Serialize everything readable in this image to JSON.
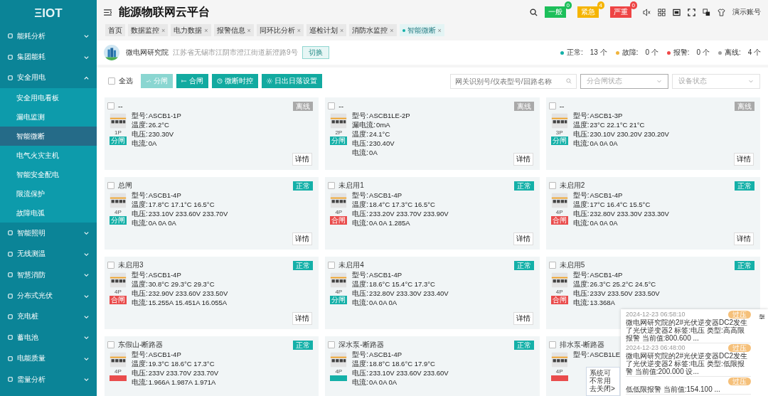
{
  "logo": "ΞIOT",
  "sidebar": {
    "items": [
      {
        "label": "能耗分析",
        "expanded": false
      },
      {
        "label": "集团能耗",
        "expanded": false
      },
      {
        "label": "安全用电",
        "expanded": true,
        "children": [
          {
            "label": "安全用电看板",
            "selected": false
          },
          {
            "label": "漏电监测",
            "selected": false
          },
          {
            "label": "智能微断",
            "selected": true
          },
          {
            "label": "电气火灾主机",
            "selected": false
          },
          {
            "label": "智能安全配电",
            "selected": false
          },
          {
            "label": "限流保护",
            "selected": false
          },
          {
            "label": "故障电弧",
            "selected": false
          }
        ]
      },
      {
        "label": "智能照明",
        "expanded": false
      },
      {
        "label": "无线测温",
        "expanded": false
      },
      {
        "label": "智慧消防",
        "expanded": false
      },
      {
        "label": "分布式光伏",
        "expanded": false
      },
      {
        "label": "充电桩",
        "expanded": false
      },
      {
        "label": "蓄电池",
        "expanded": false
      },
      {
        "label": "电能质量",
        "expanded": false
      },
      {
        "label": "需量分析",
        "expanded": false
      }
    ]
  },
  "header": {
    "title": "能源物联网云平台",
    "alarms": [
      {
        "label": "一般",
        "count": "0",
        "color": "#1dbf5a"
      },
      {
        "label": "紧急",
        "count": "4",
        "color": "#f5b400"
      },
      {
        "label": "严重",
        "count": "0",
        "color": "#ee4444"
      }
    ],
    "account": "演示账号"
  },
  "tabs": [
    {
      "label": "首页",
      "selected": false
    },
    {
      "label": "数据监控",
      "close": "×",
      "selected": false
    },
    {
      "label": "电力数据",
      "close": "×",
      "selected": false
    },
    {
      "label": "报警信息",
      "close": "×",
      "selected": false
    },
    {
      "label": "同环比分析",
      "close": "×",
      "selected": false
    },
    {
      "label": "巡检计划",
      "close": "×",
      "selected": false
    },
    {
      "label": "消防水监控",
      "close": "×",
      "selected": false
    },
    {
      "label": "智能微断",
      "close": "×",
      "selected": true
    }
  ],
  "site": {
    "name": "微电网研究院",
    "address": "江苏省无锡市江阴市澄江街道新澄路9号",
    "switch_button": "切换",
    "stats": [
      {
        "label": "正常:",
        "count": "13 个",
        "color": "#14b0a8"
      },
      {
        "label": "故障:",
        "count": "0 个",
        "color": "#f0b43c"
      },
      {
        "label": "报警:",
        "count": "0 个",
        "color": "#f04848"
      },
      {
        "label": "离线:",
        "count": "4 个",
        "color": "#a0a0a0"
      }
    ]
  },
  "toolbar": {
    "select_all": {
      "label": "全选",
      "checked": false
    },
    "buttons": [
      {
        "label": "分闸",
        "disabled": true
      },
      {
        "label": "合闸",
        "disabled": false
      },
      {
        "label": "微断时控",
        "disabled": false
      },
      {
        "label": "日出日落设置",
        "disabled": false
      }
    ],
    "search": {
      "placeholder": "网关识别号/仪表型号/回路名称"
    },
    "filters": [
      {
        "placeholder": "分合闸状态",
        "focused": true
      },
      {
        "placeholder": "设备状态",
        "focused": false
      }
    ]
  },
  "cards": [
    {
      "name": "--",
      "checked": false,
      "status": {
        "label": "离线",
        "color": "#a9a9a9"
      },
      "poles": "1P",
      "switch": {
        "label": "分闸",
        "color": "#14b0a8"
      },
      "detail": "详情",
      "fields": [
        {
          "label": "型号:",
          "value": "ASCB1-1P"
        },
        {
          "label": "温度:",
          "value": "26.2°C"
        },
        {
          "label": "电压:",
          "value": "230.30V"
        },
        {
          "label": "电流:",
          "value": "0A"
        }
      ]
    },
    {
      "name": "--",
      "checked": false,
      "status": {
        "label": "离线",
        "color": "#a9a9a9"
      },
      "poles": "2P",
      "switch": {
        "label": "分闸",
        "color": "#14b0a8"
      },
      "detail": "详情",
      "fields": [
        {
          "label": "型号:",
          "value": "ASCB1LE-2P"
        },
        {
          "label": "漏电流:",
          "value": "0mA"
        },
        {
          "label": "温度:",
          "value": "24.1°C"
        },
        {
          "label": "电压:",
          "value": "230.40V"
        },
        {
          "label": "电流:",
          "value": "0A"
        }
      ]
    },
    {
      "name": "--",
      "checked": false,
      "status": {
        "label": "离线",
        "color": "#a9a9a9"
      },
      "poles": "3P",
      "switch": {
        "label": "分闸",
        "color": "#14b0a8"
      },
      "detail": "详情",
      "fields": [
        {
          "label": "型号:",
          "value": "ASCB1-3P"
        },
        {
          "label": "温度:",
          "value": "23°C 22.1°C 21°C"
        },
        {
          "label": "电压:",
          "value": "230.10V 230.20V 230.20V"
        },
        {
          "label": "电流:",
          "value": "0A 0A 0A"
        }
      ]
    },
    {
      "name": "总闸",
      "checked": false,
      "status": {
        "label": "正常",
        "color": "#14b0a8"
      },
      "poles": "4P",
      "switch": {
        "label": "分闸",
        "color": "#14b0a8"
      },
      "detail": "详情",
      "fields": [
        {
          "label": "型号:",
          "value": "ASCB1-4P"
        },
        {
          "label": "温度:",
          "value": "17.8°C 17.1°C 16.5°C"
        },
        {
          "label": "电压:",
          "value": "233.10V 233.60V 233.70V"
        },
        {
          "label": "电流:",
          "value": "0A 0A 0A"
        }
      ]
    },
    {
      "name": "未启用1",
      "checked": false,
      "status": {
        "label": "正常",
        "color": "#14b0a8"
      },
      "poles": "4P",
      "switch": {
        "label": "合闸",
        "color": "#e94c4c"
      },
      "detail": "详情",
      "fields": [
        {
          "label": "型号:",
          "value": "ASCB1-4P"
        },
        {
          "label": "温度:",
          "value": "18.4°C 17.3°C 16.5°C"
        },
        {
          "label": "电压:",
          "value": "233.20V 233.70V 233.90V"
        },
        {
          "label": "电流:",
          "value": "0A 0A 1.285A"
        }
      ]
    },
    {
      "name": "未启用2",
      "checked": false,
      "status": {
        "label": "正常",
        "color": "#14b0a8"
      },
      "poles": "4P",
      "switch": {
        "label": "合闸",
        "color": "#e94c4c"
      },
      "detail": "详情",
      "fields": [
        {
          "label": "型号:",
          "value": "ASCB1-4P"
        },
        {
          "label": "温度:",
          "value": "17°C 16.4°C 15.5°C"
        },
        {
          "label": "电压:",
          "value": "232.80V 233.30V 233.30V"
        },
        {
          "label": "电流:",
          "value": "0A 0A 0A"
        }
      ]
    },
    {
      "name": "未启用3",
      "checked": false,
      "status": {
        "label": "正常",
        "color": "#14b0a8"
      },
      "poles": "4P",
      "switch": {
        "label": "合闸",
        "color": "#e94c4c"
      },
      "detail": "详情",
      "fields": [
        {
          "label": "型号:",
          "value": "ASCB1-4P"
        },
        {
          "label": "温度:",
          "value": "30.8°C 29.3°C 29.3°C"
        },
        {
          "label": "电压:",
          "value": "232.90V 233.60V 233.50V"
        },
        {
          "label": "电流:",
          "value": "15.255A 15.451A 16.055A"
        }
      ]
    },
    {
      "name": "未启用4",
      "checked": false,
      "status": {
        "label": "正常",
        "color": "#14b0a8"
      },
      "poles": "4P",
      "switch": {
        "label": "分闸",
        "color": "#14b0a8"
      },
      "detail": "详情",
      "fields": [
        {
          "label": "型号:",
          "value": "ASCB1-4P"
        },
        {
          "label": "温度:",
          "value": "18.6°C 15.4°C 17.3°C"
        },
        {
          "label": "电压:",
          "value": "232.80V 233.30V 233.40V"
        },
        {
          "label": "电流:",
          "value": "0A 0A 0A"
        }
      ]
    },
    {
      "name": "未启用5",
      "checked": false,
      "status": {
        "label": "正常",
        "color": "#14b0a8"
      },
      "poles": "4P",
      "switch": {
        "label": "合闸",
        "color": "#e94c4c"
      },
      "fields": [
        {
          "label": "型号:",
          "value": "ASCB1-4P"
        },
        {
          "label": "温度:",
          "value": "26.3°C 25.2°C 24.5°C"
        },
        {
          "label": "电压:",
          "value": "233V 233.50V 233.50V"
        },
        {
          "label": "电流:",
          "value": "13.368A"
        }
      ]
    },
    {
      "name": "东假山-断路器",
      "checked": false,
      "status": {
        "label": "正常",
        "color": "#14b0a8"
      },
      "poles": "4P",
      "switch": {
        "color": "#e94c4c"
      },
      "fields": [
        {
          "label": "型号:",
          "value": "ASCB1-4P"
        },
        {
          "label": "温度:",
          "value": "19.3°C 18.6°C 17.3°C"
        },
        {
          "label": "电压:",
          "value": "233V 233.70V 233.70V"
        },
        {
          "label": "电流:",
          "value": "1.966A 1.987A 1.971A"
        }
      ]
    },
    {
      "name": "深水泵-断路器",
      "checked": false,
      "status": {
        "label": "正常",
        "color": "#14b0a8"
      },
      "poles": "4P",
      "switch": {
        "color": "#14b0a8"
      },
      "fields": [
        {
          "label": "型号:",
          "value": "ASCB1-4P"
        },
        {
          "label": "温度:",
          "value": "18.8°C 18.6°C 17.9°C"
        },
        {
          "label": "电压:",
          "value": "233.10V 233.60V 233.60V"
        },
        {
          "label": "电流:",
          "value": "0A 0A 0A"
        }
      ]
    },
    {
      "name": "排水泵-断路器",
      "checked": false,
      "poles": "4P",
      "switch": {
        "color": "#e94c4c"
      },
      "fields": [
        {
          "label": "型号:",
          "value": "ASCB1LE"
        }
      ]
    }
  ],
  "popup": {
    "lines": [
      "系统可",
      "不常用"
    ],
    "link": "去关闭>"
  },
  "notifications": [
    {
      "time": "2024-12-23 06:58:10",
      "tag": "过压",
      "text": "微电网研究院的2#光伏逆变器DC2发生了光伏逆变器2 标签:电压 类型:高高限报警 当前值:800.600 ..."
    },
    {
      "time": "2024-12-23 06:48:00",
      "tag": "过压",
      "text": "微电网研究院的2#光伏逆变器DC2发生了光伏逆变器2 标签:电压 类型:低限报警 当前值:200.000 设..."
    },
    {
      "tag": "过压",
      "text": "低低限报警 当前值:154.100 ..."
    }
  ]
}
